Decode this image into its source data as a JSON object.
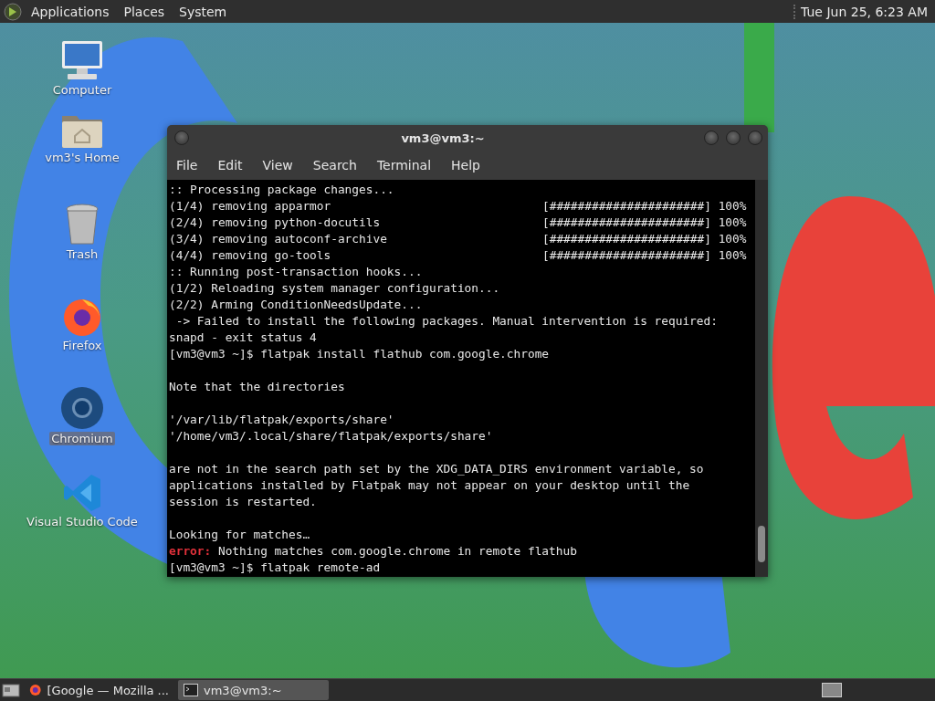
{
  "top_panel": {
    "menus": [
      "Applications",
      "Places",
      "System"
    ],
    "clock": "Tue Jun 25,  6:23 AM"
  },
  "desktop_icons": [
    {
      "label": "Computer",
      "kind": "computer",
      "selected": false
    },
    {
      "label": "vm3's Home",
      "kind": "home",
      "selected": false
    },
    {
      "label": "Trash",
      "kind": "trash",
      "selected": false
    },
    {
      "label": "Firefox",
      "kind": "firefox",
      "selected": false
    },
    {
      "label": "Chromium",
      "kind": "chromium",
      "selected": true
    },
    {
      "label": "Visual Studio Code",
      "kind": "vscode",
      "selected": false
    }
  ],
  "terminal": {
    "title": "vm3@vm3:~",
    "menu": [
      "File",
      "Edit",
      "View",
      "Search",
      "Terminal",
      "Help"
    ],
    "lines": [
      {
        "kind": "plain",
        "text": ":: Processing package changes..."
      },
      {
        "kind": "progress",
        "text": "(1/4) removing apparmor",
        "bar": "[######################]",
        "percent": "100%"
      },
      {
        "kind": "progress",
        "text": "(2/4) removing python-docutils",
        "bar": "[######################]",
        "percent": "100%"
      },
      {
        "kind": "progress",
        "text": "(3/4) removing autoconf-archive",
        "bar": "[######################]",
        "percent": "100%"
      },
      {
        "kind": "progress",
        "text": "(4/4) removing go-tools",
        "bar": "[######################]",
        "percent": "100%"
      },
      {
        "kind": "plain",
        "text": ":: Running post-transaction hooks..."
      },
      {
        "kind": "plain",
        "text": "(1/2) Reloading system manager configuration..."
      },
      {
        "kind": "plain",
        "text": "(2/2) Arming ConditionNeedsUpdate..."
      },
      {
        "kind": "plain",
        "text": " -> Failed to install the following packages. Manual intervention is required:"
      },
      {
        "kind": "plain",
        "text": "snapd - exit status 4"
      },
      {
        "kind": "plain",
        "text": "[vm3@vm3 ~]$ flatpak install flathub com.google.chrome"
      },
      {
        "kind": "blank"
      },
      {
        "kind": "plain",
        "text": "Note that the directories"
      },
      {
        "kind": "blank"
      },
      {
        "kind": "plain",
        "text": "'/var/lib/flatpak/exports/share'"
      },
      {
        "kind": "plain",
        "text": "'/home/vm3/.local/share/flatpak/exports/share'"
      },
      {
        "kind": "blank"
      },
      {
        "kind": "plain",
        "text": "are not in the search path set by the XDG_DATA_DIRS environment variable, so"
      },
      {
        "kind": "plain",
        "text": "applications installed by Flatpak may not appear on your desktop until the"
      },
      {
        "kind": "plain",
        "text": "session is restarted."
      },
      {
        "kind": "blank"
      },
      {
        "kind": "plain",
        "text": "Looking for matches…"
      },
      {
        "kind": "error",
        "label": "error:",
        "text": "Nothing matches com.google.chrome in remote flathub"
      },
      {
        "kind": "plain",
        "text": "[vm3@vm3 ~]$ flatpak remote-ad"
      }
    ]
  },
  "taskbar": {
    "tasks": [
      {
        "label": "[Google — Mozilla ...",
        "kind": "firefox",
        "selected": false
      },
      {
        "label": "vm3@vm3:~",
        "kind": "terminal",
        "selected": true
      }
    ]
  }
}
